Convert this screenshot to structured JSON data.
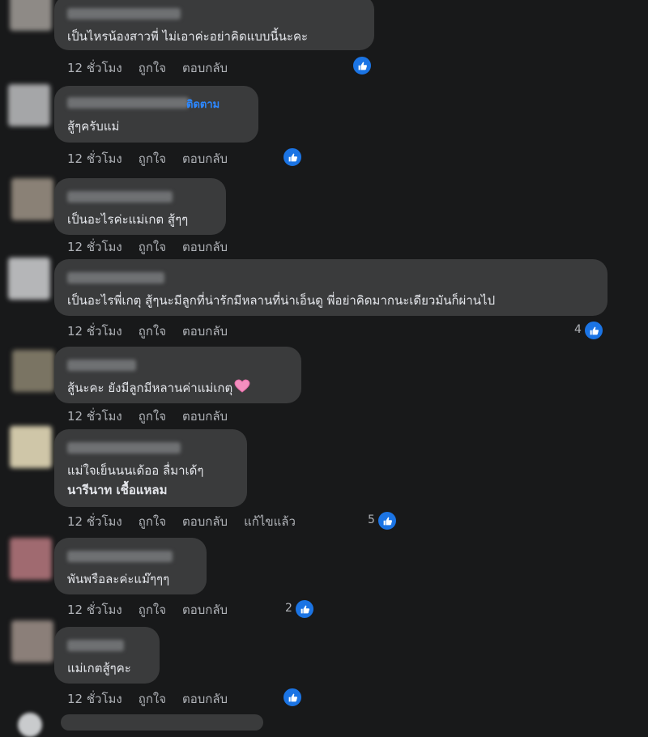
{
  "ui": {
    "like_label": "ถูกใจ",
    "reply_label": "ตอบกลับ",
    "follow_label": "ติดตาม"
  },
  "colors": {
    "background": "#18191a",
    "bubble": "#3a3b3c",
    "accent": "#1b74e4"
  },
  "comments": [
    {
      "text": "เป็นไหรน้องสาวพี่ ไม่เอาค่ะอย่าคิดแบบนี้นะคะ",
      "time": "12 ชั่วโมง",
      "reaction_icon": "like-icon"
    },
    {
      "text": "สู้ๆครับแม่",
      "time": "12 ชั่วโมง",
      "reaction_icon": "like-icon"
    },
    {
      "text": "เป็นอะไรค่ะแม่เกต สู้ๆๆ",
      "time": "12 ชั่วโมง"
    },
    {
      "text": "เป็นอะไรพี่เกตุ สู้ๆนะมีลูกที่น่ารักมีหลานที่น่าเอ็นดู พี่อย่าคิดมากนะเดียวมันก็ผ่านไป",
      "time": "12 ชั่วโมง",
      "reaction_count": "4",
      "reaction_icon": "like-icon"
    },
    {
      "text": "สู้นะคะ ยังมีลูกมีหลานค่าแม่เกตุ",
      "emoji": "pink-heart-icon",
      "time": "12 ชั่วโมง"
    },
    {
      "text": "แม่ใจเย็นนนเด้ออ ลื่มาเด้ๆ",
      "mention": "นารีนาท เชื้อแหลม",
      "time": "12 ชั่วโมง",
      "edited_label": "แก้ไขแล้ว",
      "reaction_count": "5",
      "reaction_icon": "like-icon"
    },
    {
      "text": "พันพรือละค่ะแม๊ๆๆๆ",
      "time": "12 ชั่วโมง",
      "reaction_count": "2",
      "reaction_icon": "like-icon"
    },
    {
      "text": "แม่เกตสู้ๆคะ",
      "time": "12 ชั่วโมง",
      "reaction_icon": "like-icon"
    }
  ]
}
